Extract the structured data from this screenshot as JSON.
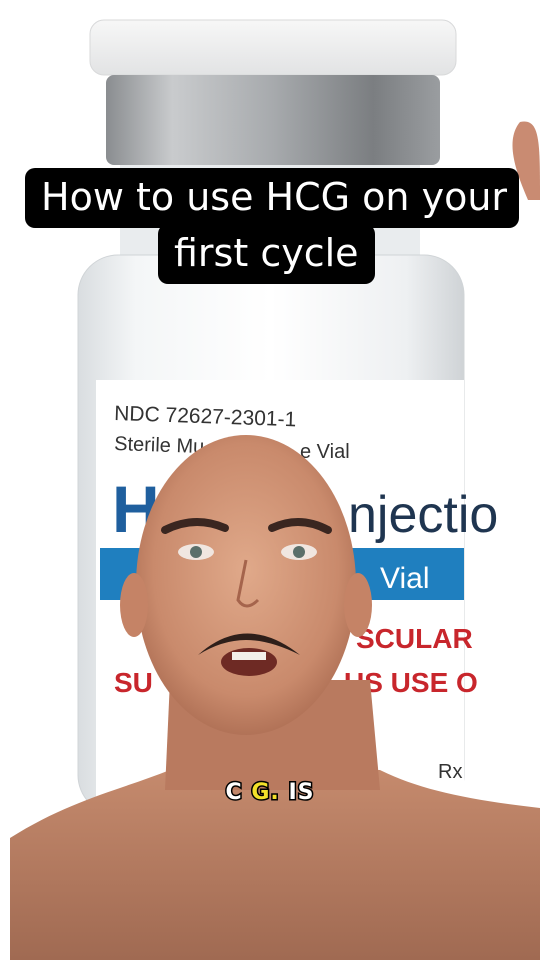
{
  "vial_label": {
    "ndc": "NDC 72627-2301-1",
    "line2_left": "Sterile Mu",
    "line2_right": "e Vial",
    "big_text": "njectio",
    "big_text_left": "H",
    "band_text": "Vial",
    "warn_line1_right": "SCULAR",
    "warn_line2_left": "SU",
    "warn_line2_right": "US USE O",
    "rx": "Rx"
  },
  "caption": {
    "line1": "How to use HCG on your",
    "line2": "first cycle"
  },
  "subtitle": {
    "pre": "C",
    "highlight": "G.",
    "post": "IS"
  },
  "colors": {
    "caption_bg": "#000000",
    "caption_text": "#ffffff",
    "label_blue": "#1f5f9e",
    "label_band": "#1f7fbf",
    "label_red": "#c8262c",
    "subtitle_highlight": "#f3e02a"
  }
}
